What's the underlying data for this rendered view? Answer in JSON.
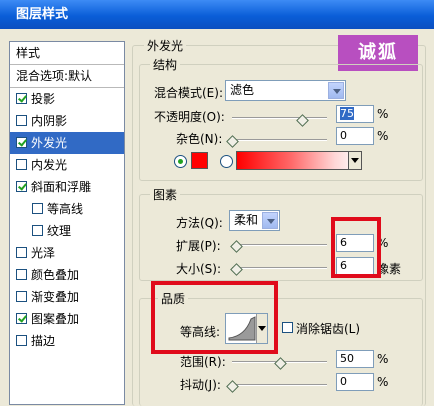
{
  "window": {
    "title": "图层样式"
  },
  "left_panel": {
    "header": "样式",
    "blending": "混合选项:默认",
    "items": [
      {
        "label": "投影",
        "checked": true,
        "selected": false
      },
      {
        "label": "内阴影",
        "checked": false,
        "selected": false
      },
      {
        "label": "外发光",
        "checked": true,
        "selected": true
      },
      {
        "label": "内发光",
        "checked": false,
        "selected": false
      },
      {
        "label": "斜面和浮雕",
        "checked": true,
        "selected": false
      },
      {
        "label": "等高线",
        "checked": false,
        "selected": false
      },
      {
        "label": "纹理",
        "checked": false,
        "selected": false
      },
      {
        "label": "光泽",
        "checked": false,
        "selected": false
      },
      {
        "label": "颜色叠加",
        "checked": false,
        "selected": false
      },
      {
        "label": "渐变叠加",
        "checked": false,
        "selected": false
      },
      {
        "label": "图案叠加",
        "checked": true,
        "selected": false
      },
      {
        "label": "描边",
        "checked": false,
        "selected": false
      }
    ]
  },
  "outer_glow": {
    "title": "外发光",
    "structure": {
      "title": "结构",
      "blend_mode_label": "混合模式(E):",
      "blend_mode_value": "滤色",
      "opacity_label": "不透明度(O):",
      "opacity_value": "75",
      "opacity_unit": "%",
      "noise_label": "杂色(N):",
      "noise_value": "0",
      "noise_unit": "%",
      "color": "#ff0000"
    },
    "elements": {
      "title": "图素",
      "method_label": "方法(Q):",
      "method_value": "柔和",
      "spread_label": "扩展(P):",
      "spread_value": "6",
      "spread_unit": "%",
      "size_label": "大小(S):",
      "size_value": "6",
      "size_unit": "像素"
    },
    "quality": {
      "title": "品质",
      "contour_label": "等高线:",
      "antialias_label": "消除锯齿(L)",
      "range_label": "范围(R):",
      "range_value": "50",
      "range_unit": "%",
      "jitter_label": "抖动(J):",
      "jitter_value": "0",
      "jitter_unit": "%"
    }
  },
  "watermark": {
    "text": "诚狐"
  }
}
